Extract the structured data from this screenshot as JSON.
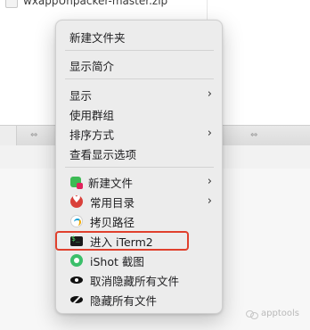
{
  "finder": {
    "file_name": "wxappUnpacker-master.zip"
  },
  "menu": {
    "new_folder": "新建文件夹",
    "show_info": "显示简介",
    "show": "显示",
    "use_groups": "使用群组",
    "sort_by": "排序方式",
    "view_options": "查看显示选项",
    "new_file": "新建文件",
    "favorites": "常用目录",
    "copy_path": "拷贝路径",
    "open_iterm": "进入 iTerm2",
    "ishot": "iShot 截图",
    "hide_all": "取消隐藏所有文件",
    "show_all": "隐藏所有文件",
    "submenu_indicator": "›"
  },
  "watermark": {
    "text": "apptools"
  },
  "colors": {
    "highlight": "#e0402d",
    "menu_bg": "#ececec"
  }
}
